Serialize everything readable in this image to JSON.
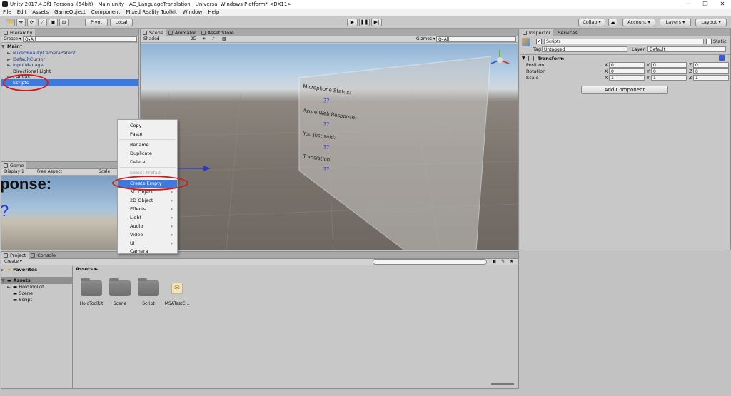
{
  "window": {
    "title": "Unity 2017.4.3f1 Personal (64bit) - Main.unity - AC_LanguageTranslation - Universal Windows Platform* <DX11>",
    "min": "─",
    "max": "❐",
    "close": "✕"
  },
  "menu": [
    "File",
    "Edit",
    "Assets",
    "GameObject",
    "Component",
    "Mixed Reality Toolkit",
    "Window",
    "Help"
  ],
  "toolbar": {
    "pivot": "Pivot",
    "local": "Local",
    "collab": "Collab ▾",
    "account": "Account ▾",
    "layers": "Layers ▾",
    "layout": "Layout ▾"
  },
  "hierarchy": {
    "tab": "Hierarchy",
    "create": "Create ▾",
    "search": "Q▾All",
    "scene": "Main*",
    "items": [
      "MixedRealityCameraParent",
      "DefaultCursor",
      "InputManager",
      "Directional Light",
      "Canvas",
      "Scripts"
    ]
  },
  "scene": {
    "tabs": [
      "Scene",
      "Animator",
      "Asset Store"
    ],
    "shaded": "Shaded",
    "mode2d": "2D",
    "gizmos": "Gizmos ▾",
    "search": "Q▾All",
    "canvas_texts": [
      "Microphone Status:",
      "??",
      "Azure Web Response:",
      "??",
      "You just said:",
      "??",
      "Translation:",
      "??"
    ]
  },
  "game": {
    "tab": "Game",
    "display": "Display 1",
    "aspect": "Free Aspect",
    "scale": "Scale",
    "text_big": "ponse:",
    "text_q": "?"
  },
  "context_menu": {
    "items": [
      {
        "label": "Copy",
        "state": "normal",
        "sub": false
      },
      {
        "label": "Paste",
        "state": "normal",
        "sub": false
      },
      {
        "sep": true
      },
      {
        "label": "Rename",
        "state": "normal",
        "sub": false
      },
      {
        "label": "Duplicate",
        "state": "normal",
        "sub": false
      },
      {
        "label": "Delete",
        "state": "normal",
        "sub": false
      },
      {
        "sep": true
      },
      {
        "label": "Select Prefab",
        "state": "disabled",
        "sub": false
      },
      {
        "sep": true
      },
      {
        "label": "Create Empty",
        "state": "selected",
        "sub": false
      },
      {
        "label": "3D Object",
        "state": "normal",
        "sub": true
      },
      {
        "label": "2D Object",
        "state": "normal",
        "sub": true
      },
      {
        "label": "Effects",
        "state": "normal",
        "sub": true
      },
      {
        "label": "Light",
        "state": "normal",
        "sub": true
      },
      {
        "label": "Audio",
        "state": "normal",
        "sub": true
      },
      {
        "label": "Video",
        "state": "normal",
        "sub": true
      },
      {
        "label": "UI",
        "state": "normal",
        "sub": true
      },
      {
        "label": "Camera",
        "state": "normal",
        "sub": false
      }
    ]
  },
  "inspector": {
    "tabs": [
      "Inspector",
      "Services"
    ],
    "object_name": "Scripts",
    "static": "Static",
    "tag_label": "Tag",
    "tag": "Untagged",
    "layer_label": "Layer",
    "layer": "Default",
    "transform": "Transform",
    "rows": [
      {
        "label": "Position",
        "x": "0",
        "y": "0",
        "z": "0"
      },
      {
        "label": "Rotation",
        "x": "0",
        "y": "0",
        "z": "0"
      },
      {
        "label": "Scale",
        "x": "1",
        "y": "1",
        "z": "1"
      }
    ],
    "add_component": "Add Component",
    "x": "X",
    "y": "Y",
    "z": "Z"
  },
  "project": {
    "tabs": [
      "Project",
      "Console"
    ],
    "create": "Create ▾",
    "favorites": "Favorites",
    "assets": "Assets",
    "breadcrumb": "Assets ►",
    "tree": [
      "HoloToolkit",
      "Scene",
      "Script"
    ],
    "files": [
      "HoloToolkit",
      "Scene",
      "Script",
      "MSATestC..."
    ]
  },
  "colors": {
    "highlight": "#3d7ae0",
    "annotation": "#d21a1a"
  }
}
